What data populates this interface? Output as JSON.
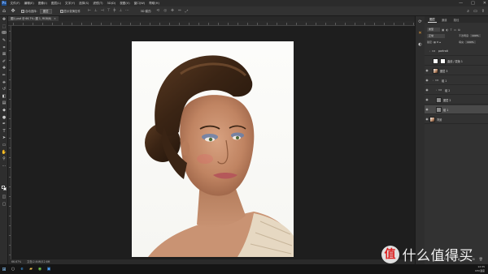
{
  "app": {
    "logo": "Ps"
  },
  "menus": [
    "文件(F)",
    "编辑(E)",
    "图像(I)",
    "图层(L)",
    "文字(Y)",
    "选择(S)",
    "滤镜(T)",
    "3D(D)",
    "视图(V)",
    "窗口(W)",
    "帮助(H)"
  ],
  "window_controls": [
    "—",
    "□",
    "✕"
  ],
  "options": {
    "auto_select_label": "自动选择:",
    "auto_select_value": "图层",
    "transform_label": "显示变换控件",
    "mode_label": "3D 模式:"
  },
  "document_tab": {
    "title": "图片.psd @ 66.7% (图 1, RGB/8)",
    "close": "×"
  },
  "status": {
    "zoom": "66.67%",
    "doc_size": "文档:2.64M/12.6M"
  },
  "panels": {
    "tabs": [
      "图层",
      "通道",
      "路径"
    ],
    "active_tab": 0
  },
  "layers_panel": {
    "kind_filter": "类型",
    "blend_mode": "正常",
    "opacity_label": "不透明度:",
    "opacity": "100%",
    "lock_label": "锁定:",
    "fill_label": "填充:",
    "fill": "100%",
    "layers": [
      {
        "name": "portrait",
        "type": "group",
        "indent": 0,
        "visible": false,
        "selected": false
      },
      {
        "name": "曲线 / 蒙版 1",
        "type": "adjust",
        "indent": 1,
        "visible": false,
        "selected": false
      },
      {
        "name": "图层 3",
        "type": "layer",
        "indent": 1,
        "visible": true,
        "selected": false
      },
      {
        "name": "组 1",
        "type": "group",
        "indent": 1,
        "visible": true,
        "selected": false
      },
      {
        "name": "组 2",
        "type": "group",
        "indent": 2,
        "visible": true,
        "selected": false
      },
      {
        "name": "图层 2",
        "type": "gray",
        "indent": 2,
        "visible": true,
        "selected": false
      },
      {
        "name": "组 1",
        "type": "gray",
        "indent": 2,
        "visible": true,
        "selected": true
      },
      {
        "name": "背景",
        "type": "layer",
        "indent": 0,
        "visible": true,
        "selected": false
      }
    ]
  },
  "taskbar": {
    "start_icon": "windows-icon",
    "tray_time": "12:35",
    "tray_date": "CPU温度"
  },
  "watermark": {
    "badge": "值",
    "text": "什么值得买"
  },
  "colors": {
    "foreground": "#000000",
    "background": "#ffffff",
    "accent": "#f2a23a",
    "ps_blue": "#1f4e8c"
  }
}
